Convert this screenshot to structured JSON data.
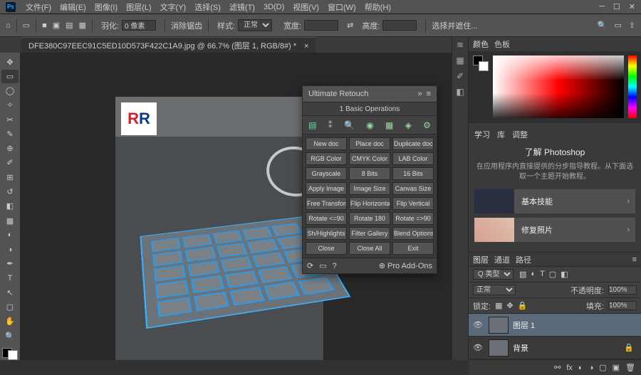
{
  "menubar": {
    "items": [
      "文件(F)",
      "编辑(E)",
      "图像(I)",
      "图层(L)",
      "文字(Y)",
      "选择(S)",
      "滤镜(T)",
      "3D(D)",
      "视图(V)",
      "窗口(W)",
      "帮助(H)"
    ]
  },
  "optionsbar": {
    "feather_label": "羽化:",
    "feather_value": "0 像素",
    "antialias": "消除锯齿",
    "style_label": "样式:",
    "style_value": "正常",
    "width_label": "宽度:",
    "height_label": "高度:",
    "select_mask": "选择并遮住..."
  },
  "tab": {
    "title": "DFE380C97EEC91C5ED10D573F422C1A9.jpg @ 66.7% (图层 1, RGB/8#) *"
  },
  "tools": [
    "move",
    "marquee",
    "lasso",
    "wand",
    "crop",
    "eyedrop",
    "heal",
    "brush",
    "stamp",
    "history",
    "eraser",
    "gradient",
    "blur",
    "dodge",
    "pen",
    "type",
    "path",
    "rect",
    "hand",
    "zoom"
  ],
  "ur_panel": {
    "title": "Ultimate Retouch",
    "sub": "1 Basic Operations",
    "btns": [
      "New doc",
      "Place doc",
      "Duplicate doc",
      "RGB Color",
      "CMYK Color",
      "LAB Color",
      "Grayscale",
      "8 Bits",
      "16 Bits",
      "Apply Image",
      "Image Size",
      "Canvas Size",
      "Free Transform",
      "Flip Horizontal",
      "Flip Vertical",
      "Rotate <=90",
      "Rotate 180",
      "Rotate =>90",
      "Sh/Highlights",
      "Filter Gallery",
      "Blend Options",
      "Close",
      "Close All",
      "Exit"
    ],
    "addons": "Pro Add-Ons"
  },
  "color_panel": {
    "tabs": [
      "颜色",
      "色板"
    ]
  },
  "learn_panel": {
    "tabs": [
      "学习",
      "库",
      "调整"
    ],
    "title": "了解 Photoshop",
    "desc": "在应用程序内直接提供的分步指导教程。从下面选取一个主题开始教程。",
    "cards": [
      {
        "label": "基本技能"
      },
      {
        "label": "修复照片"
      }
    ]
  },
  "layers_panel": {
    "tabs": [
      "图层",
      "通道",
      "路径"
    ],
    "filter_label": "Q 类型",
    "blend_mode": "正常",
    "opacity_label": "不透明度:",
    "opacity": "100%",
    "lock_label": "锁定:",
    "fill_label": "填充:",
    "fill": "100%",
    "layers": [
      {
        "name": "图层 1",
        "selected": true
      },
      {
        "name": "背景",
        "selected": false
      }
    ]
  }
}
